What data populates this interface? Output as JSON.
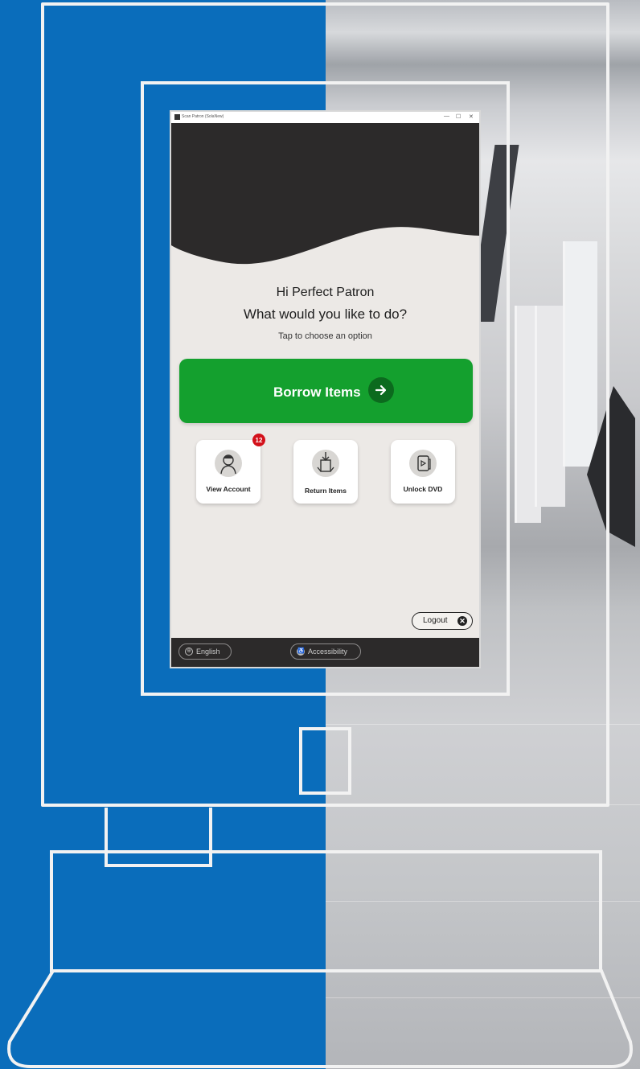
{
  "window": {
    "title": "Scan Patron (SolaNew)",
    "controls": [
      "—",
      "☐",
      "✕"
    ]
  },
  "greeting": {
    "line1": "Hi Perfect Patron",
    "line2": "What would you like to do?",
    "subtitle": "Tap to choose an option"
  },
  "borrow": {
    "label": "Borrow Items",
    "arrow": "→"
  },
  "tiles": [
    {
      "label": "View Account",
      "icon": "person-icon"
    },
    {
      "label": "Return Items",
      "icon": "return-book-icon"
    },
    {
      "label": "Unlock DVD",
      "icon": "dvd-icon"
    }
  ],
  "account_badge": {
    "count": "12"
  },
  "logout": {
    "label": "Logout",
    "icon": "close-circle-icon",
    "x": "✕"
  },
  "footer": {
    "language": {
      "label": "English",
      "icon": "globe-icon"
    },
    "accessibility": {
      "label": "Accessibility",
      "icon": "accessibility-icon"
    }
  },
  "colors": {
    "brand_blue": "#0a6dbb",
    "borrow_green": "#14a02e",
    "badge_red": "#d3111b",
    "dark": "#2c2a2a"
  }
}
